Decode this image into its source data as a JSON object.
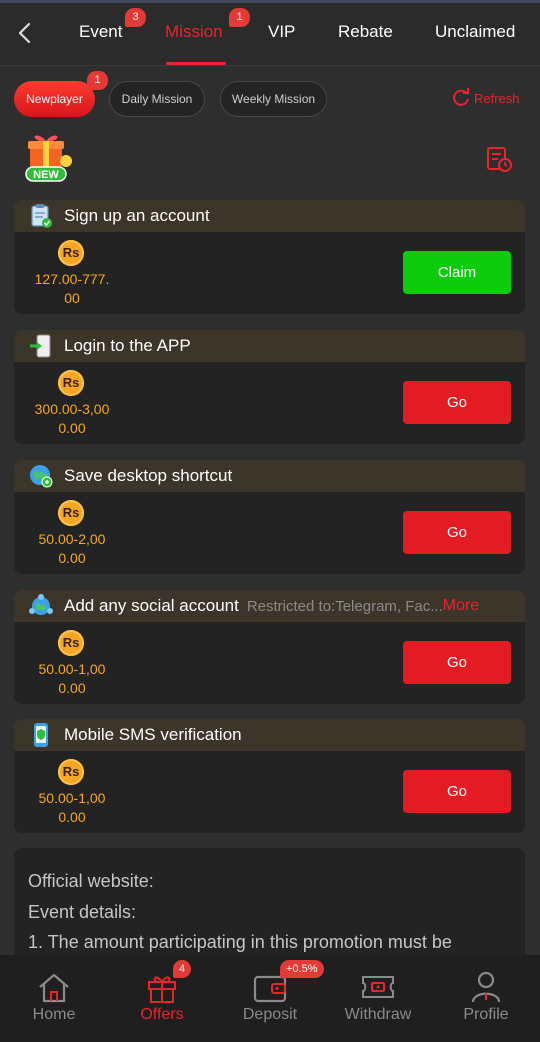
{
  "topnav": {
    "tabs": [
      {
        "label": "Event",
        "badge": "3"
      },
      {
        "label": "Mission",
        "badge": "1",
        "active": true
      },
      {
        "label": "VIP"
      },
      {
        "label": "Rebate"
      },
      {
        "label": "Unclaimed"
      }
    ]
  },
  "filters": {
    "items": [
      {
        "label": "Newplayer",
        "badge": "1",
        "active": true
      },
      {
        "label": "Daily Mission"
      },
      {
        "label": "Weekly Mission"
      }
    ],
    "refresh_label": "Refresh"
  },
  "currency_symbol": "Rs",
  "missions": [
    {
      "title": "Sign up an account",
      "icon": "clipboard-check-icon",
      "reward_line1": "127.00-777.",
      "reward_line2": "00",
      "button": "Claim",
      "button_style": "green"
    },
    {
      "title": "Login to the APP",
      "icon": "phone-login-icon",
      "reward_line1": "300.00-3,00",
      "reward_line2": "0.00",
      "button": "Go",
      "button_style": "red"
    },
    {
      "title": "Save desktop shortcut",
      "icon": "globe-shortcut-icon",
      "reward_line1": "50.00-2,00",
      "reward_line2": "0.00",
      "button": "Go",
      "button_style": "red"
    },
    {
      "title": "Add any social account",
      "restriction": "Restricted to:Telegram, Fac...",
      "more": "More",
      "icon": "social-globe-icon",
      "reward_line1": "50.00-1,00",
      "reward_line2": "0.00",
      "button": "Go",
      "button_style": "red"
    },
    {
      "title": "Mobile SMS verification",
      "icon": "phone-shield-icon",
      "reward_line1": "50.00-1,00",
      "reward_line2": "0.00",
      "button": "Go",
      "button_style": "red"
    }
  ],
  "description": {
    "lines": [
      "Official website:",
      "Event details:",
      "1. The amount participating in this promotion must be"
    ]
  },
  "bottomnav": {
    "items": [
      {
        "label": "Home",
        "icon": "home-icon"
      },
      {
        "label": "Offers",
        "icon": "gift-icon",
        "badge": "4",
        "active": true
      },
      {
        "label": "Deposit",
        "icon": "wallet-icon",
        "badge": "+0.5%"
      },
      {
        "label": "Withdraw",
        "icon": "withdraw-icon"
      },
      {
        "label": "Profile",
        "icon": "profile-icon"
      }
    ]
  },
  "colors": {
    "accent": "#e8242c",
    "claim_green": "#0ccc0c",
    "reward_gold": "#f5a623",
    "background": "#2e2e2e"
  }
}
